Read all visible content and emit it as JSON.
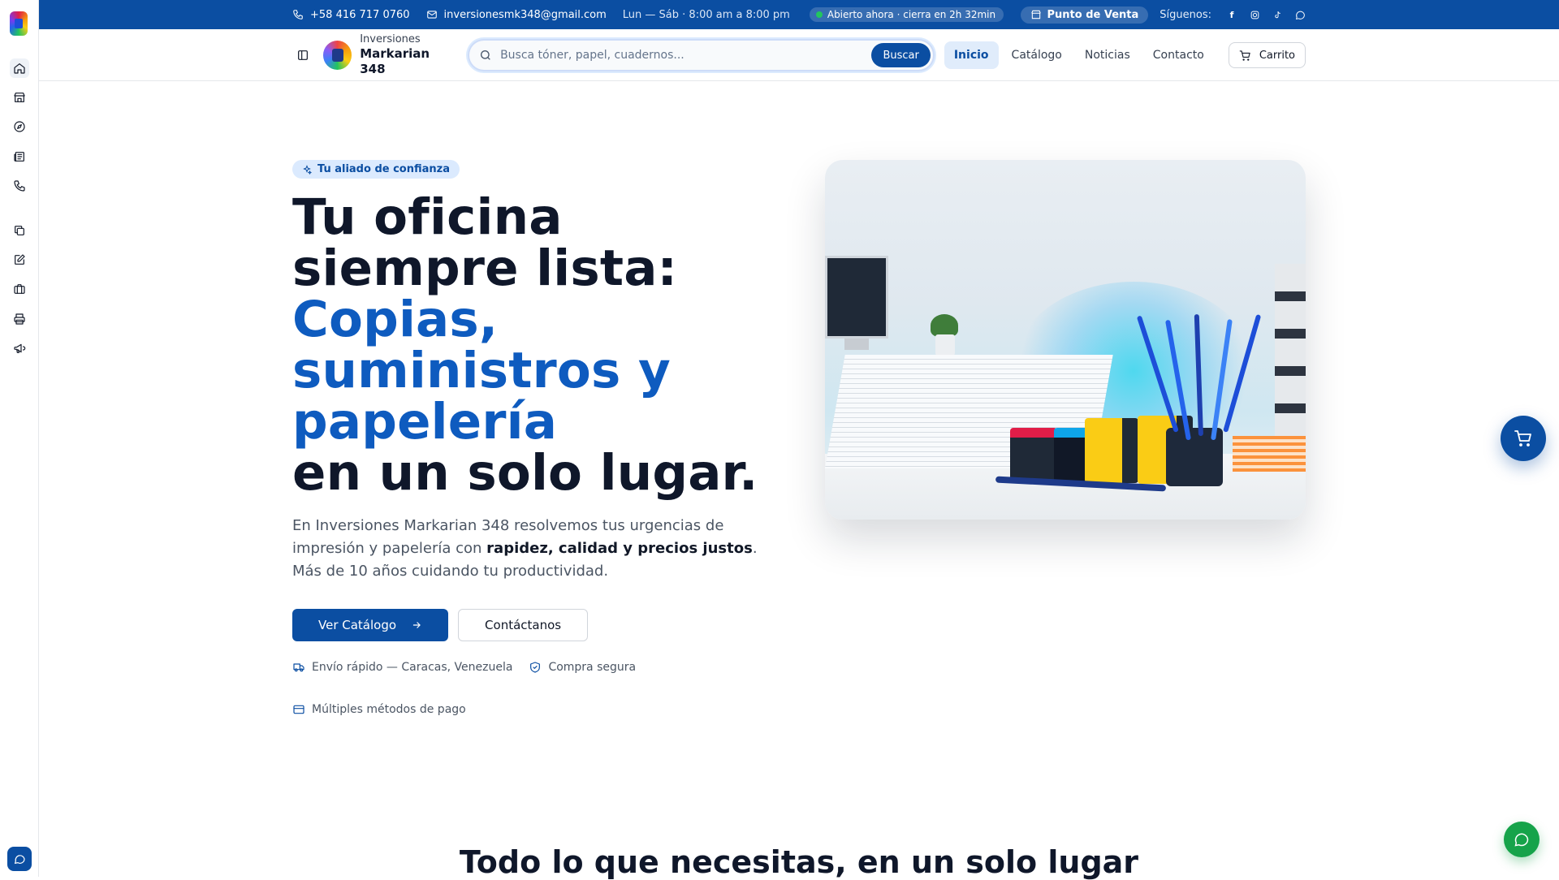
{
  "topbar": {
    "phone": "+58 416 717 0760",
    "email": "inversionesmk348@gmail.com",
    "hours": "Lun — Sáb · 8:00 am a 8:00 pm",
    "open_status": "Abierto ahora · cierra en 2h 32min",
    "pos_label": "Punto de Venta",
    "follow_label": "Síguenos:",
    "social": [
      "facebook-icon",
      "instagram-icon",
      "tiktok-icon",
      "whatsapp-icon"
    ]
  },
  "brand": {
    "small": "Inversiones",
    "big": "Markarian 348"
  },
  "search": {
    "placeholder": "Busca tóner, papel, cuadernos...",
    "button": "Buscar"
  },
  "nav": {
    "links": [
      "Inicio",
      "Catálogo",
      "Noticias",
      "Contacto"
    ],
    "active": "Inicio",
    "cart": "Carrito"
  },
  "sidebar": {
    "icons": [
      "home-icon",
      "store-icon",
      "compass-icon",
      "news-icon",
      "phone-icon",
      "copy-icon",
      "edit-icon",
      "briefcase-icon",
      "printer-icon",
      "megaphone-icon"
    ],
    "active": "home-icon"
  },
  "hero": {
    "badge": "Tu aliado de confianza",
    "title_line1": "Tu oficina siempre lista:",
    "title_accent": "Copias, suministros y papelería",
    "title_line3": "en un solo lugar.",
    "lead_before": "En Inversiones Markarian 348 resolvemos tus urgencias de impresión y papelería con ",
    "lead_bold": "rapidez, calidad y precios justos",
    "lead_after": ". Más de 10 años cuidando tu productividad.",
    "cta_primary": "Ver Catálogo",
    "cta_secondary": "Contáctanos",
    "perks": [
      "Envío rápido — Caracas, Venezuela",
      "Compra segura",
      "Múltiples métodos de pago"
    ]
  },
  "section": {
    "title": "Todo lo que necesitas, en un solo lugar"
  },
  "colors": {
    "brand": "#0b4ea2",
    "accent_text": "#0e5bbf",
    "open_dot": "#22c55e",
    "whatsapp": "#16a34a"
  }
}
